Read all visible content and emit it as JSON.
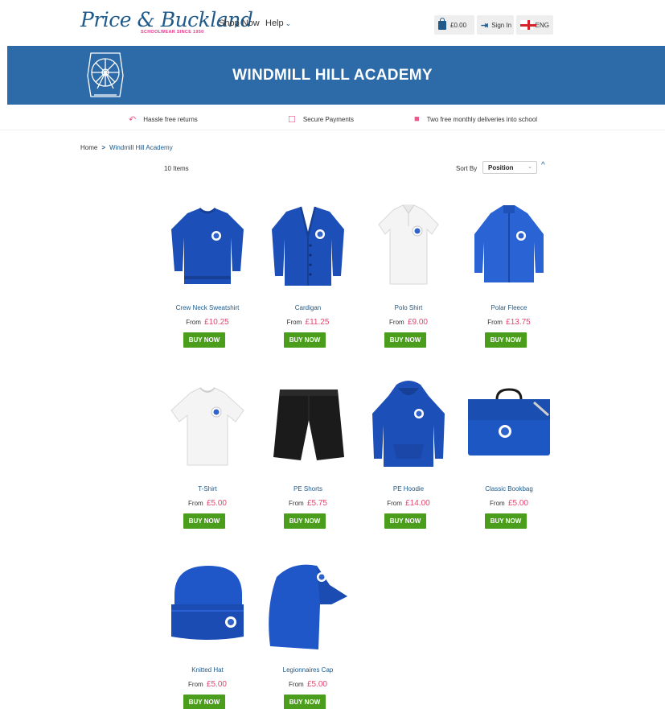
{
  "header": {
    "logo_text": "Price & Buckland",
    "logo_tagline": "SCHOOLWEAR SINCE 1950",
    "nav": {
      "shop": "Shop Now",
      "help": "Help"
    },
    "cart_total": "£0.00",
    "sign_in": "Sign In",
    "language": "ENG"
  },
  "banner": {
    "title": "WINDMILL HILL ACADEMY"
  },
  "usps": [
    {
      "icon": "returns-arrow-icon",
      "text": "Hassle free returns"
    },
    {
      "icon": "lock-icon",
      "text": "Secure Payments"
    },
    {
      "icon": "truck-icon",
      "text": "Two free monthly deliveries into school"
    }
  ],
  "breadcrumb": {
    "home": "Home",
    "separator": ">",
    "current": "Windmill Hill Academy"
  },
  "toolbar": {
    "count": "10 Items",
    "sort_label": "Sort By",
    "sort_value": "Position",
    "sort_direction": "^"
  },
  "products": [
    {
      "name": "Crew Neck Sweatshirt",
      "from": "From",
      "price": "£10.25",
      "buy": "BUY NOW"
    },
    {
      "name": "Cardigan",
      "from": "From",
      "price": "£11.25",
      "buy": "BUY NOW"
    },
    {
      "name": "Polo Shirt",
      "from": "From",
      "price": "£9.00",
      "buy": "BUY NOW"
    },
    {
      "name": "Polar Fleece",
      "from": "From",
      "price": "£13.75",
      "buy": "BUY NOW"
    },
    {
      "name": "T-Shirt",
      "from": "From",
      "price": "£5.00",
      "buy": "BUY NOW"
    },
    {
      "name": "PE Shorts",
      "from": "From",
      "price": "£5.75",
      "buy": "BUY NOW"
    },
    {
      "name": "PE Hoodie",
      "from": "From",
      "price": "£14.00",
      "buy": "BUY NOW"
    },
    {
      "name": "Classic Bookbag",
      "from": "From",
      "price": "£5.00",
      "buy": "BUY NOW"
    },
    {
      "name": "Knitted Hat",
      "from": "From",
      "price": "£5.00",
      "buy": "BUY NOW"
    },
    {
      "name": "Legionnaires Cap",
      "from": "From",
      "price": "£5.00",
      "buy": "BUY NOW"
    }
  ],
  "colors": {
    "brand_blue": "#2d6aa8",
    "buy_green": "#4a9e1c",
    "price_pink": "#e2466f",
    "link_blue": "#1f5a8a"
  }
}
